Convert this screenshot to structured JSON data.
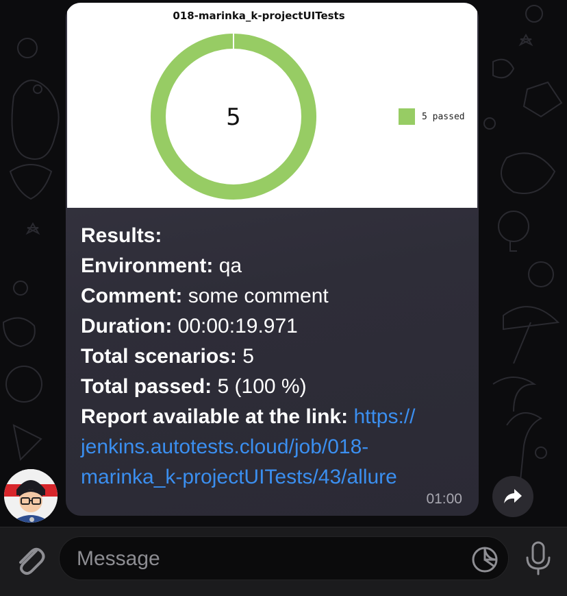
{
  "chart": {
    "title": "018-marinka_k-projectUITests",
    "center_value": "5",
    "legend_label": "5 passed",
    "passed_color": "#97cc64"
  },
  "chart_data": {
    "type": "pie",
    "title": "018-marinka_k-projectUITests",
    "categories": [
      "passed"
    ],
    "values": [
      5
    ],
    "legend": [
      "5 passed"
    ],
    "legend_position": "right",
    "colors": [
      "#97cc64"
    ]
  },
  "message": {
    "results_label": "Results:",
    "environment_label": "Environment:",
    "environment_value": "qa",
    "comment_label": "Comment:",
    "comment_value": "some comment",
    "duration_label": "Duration:",
    "duration_value": "00:00:19.971",
    "total_scenarios_label": "Total scenarios:",
    "total_scenarios_value": "5",
    "total_passed_label": "Total passed:",
    "total_passed_value": "5 (100 %)",
    "report_label": "Report available at the link:",
    "report_link_line1": "https://",
    "report_link_line2": "jenkins.autotests.cloud/job/018-",
    "report_link_line3": "marinka_k-projectUITests/43/allure",
    "time": "01:00"
  },
  "input": {
    "placeholder": "Message"
  },
  "icons": {
    "attach": "paperclip-icon",
    "sticker": "sticker-icon",
    "mic": "microphone-icon",
    "forward": "forward-arrow-icon"
  },
  "colors": {
    "link": "#3b8ff0",
    "bubble": "#2e2d38",
    "background": "#0c0c0e"
  }
}
